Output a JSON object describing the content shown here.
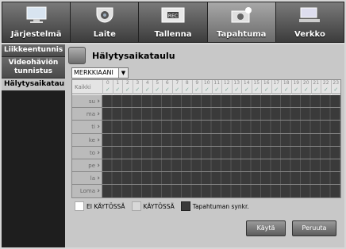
{
  "tabs": [
    {
      "label": "Järjestelmä",
      "icon": "monitor-icon",
      "active": false
    },
    {
      "label": "Laite",
      "icon": "camera-icon",
      "active": false
    },
    {
      "label": "Tallenna",
      "icon": "rec-icon",
      "active": false
    },
    {
      "label": "Tapahtuma",
      "icon": "event-icon",
      "active": true
    },
    {
      "label": "Verkko",
      "icon": "network-icon",
      "active": false
    }
  ],
  "sidebar": {
    "items": [
      {
        "label": "Liikkeentunnis",
        "active": false
      },
      {
        "label": "Videohäviön tunnistus",
        "active": false
      },
      {
        "label": "Hälytysaikatau",
        "active": true
      }
    ]
  },
  "page": {
    "title": "Hälytysaikataulu",
    "sensor_select": "MERKKIAANI"
  },
  "schedule": {
    "corner_label": "Kaikki",
    "hours": [
      "0",
      "1",
      "2",
      "3",
      "4",
      "5",
      "6",
      "7",
      "8",
      "9",
      "10",
      "11",
      "12",
      "13",
      "14",
      "15",
      "16",
      "17",
      "18",
      "19",
      "20",
      "21",
      "22",
      "23"
    ],
    "days": [
      "su",
      "ma",
      "ti",
      "ke",
      "to",
      "pe",
      "la",
      "Loma"
    ]
  },
  "legend": {
    "off": "EI KÄYTÖSSÄ",
    "on": "KÄYTÖSSÄ",
    "sync": "Tapahtuman synkr."
  },
  "buttons": {
    "apply": "Käytä",
    "cancel": "Peruuta"
  },
  "colors": {
    "off": "#ffffff",
    "on": "#d8d8d8",
    "sync": "#3a3a3a"
  }
}
